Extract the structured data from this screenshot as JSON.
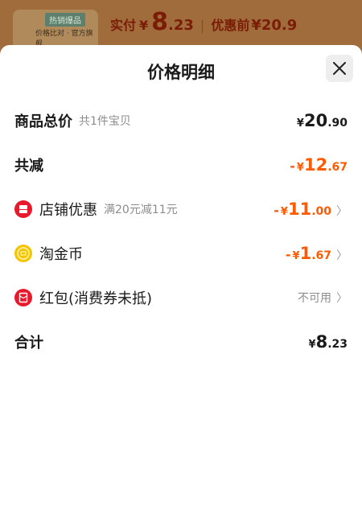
{
  "background": {
    "thumb_tag": "热销爆品",
    "thumb_line": "价格比对 · 官方旗舰",
    "actual_label": "实付",
    "actual_currency": "¥",
    "actual_int": "8",
    "actual_dec": ".23",
    "separator": "|",
    "before_label": "优惠前",
    "before_value": "¥20.9"
  },
  "sheet": {
    "title": "价格明细",
    "close_icon": "close-icon"
  },
  "rows": {
    "total": {
      "label": "商品总价",
      "sub": "共1件宝贝",
      "currency": "¥",
      "int": "20",
      "dec": ".90"
    },
    "reduction": {
      "label": "共减",
      "minus": "-",
      "currency": "¥",
      "int": "12",
      "dec": ".67"
    },
    "store_discount": {
      "icon": "store-coupon-icon",
      "label": "店铺优惠",
      "sub": "满20元减11元",
      "minus": "-",
      "currency": "¥",
      "int": "11",
      "dec": ".00"
    },
    "gold_coin": {
      "icon": "gold-coin-icon",
      "label": "淘金币",
      "minus": "-",
      "currency": "¥",
      "int": "1",
      "dec": ".67"
    },
    "red_packet": {
      "icon": "red-packet-icon",
      "label": "红包(消费券未抵)",
      "status": "不可用"
    },
    "sum": {
      "label": "合计",
      "currency": "¥",
      "int": "8",
      "dec": ".23"
    }
  },
  "colors": {
    "accent_orange": "#ff5a00",
    "store_icon": "#e8192c",
    "coin_icon": "#f5c400",
    "packet_icon": "#e8192c"
  }
}
